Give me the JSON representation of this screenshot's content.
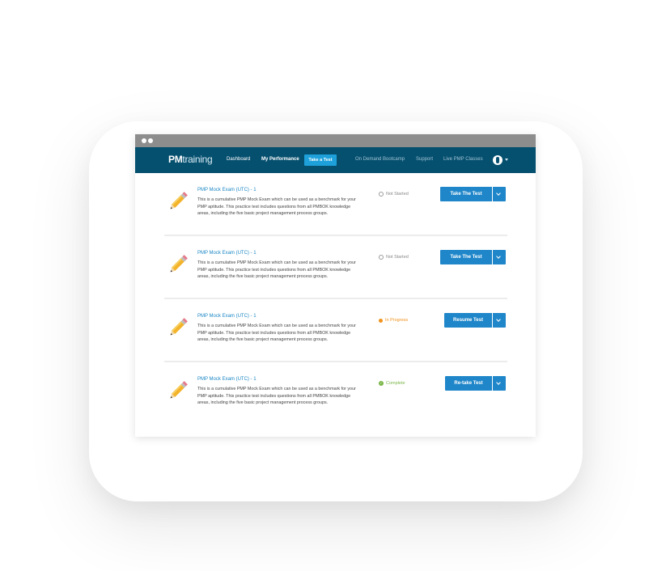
{
  "header": {
    "logo_bold": "PM",
    "logo_light": "training",
    "nav": {
      "dashboard": "Dashboard",
      "my_performance": "My Performance",
      "take_a_test": "Take a Test",
      "on_demand": "On Demand Bootcamp",
      "support": "Support",
      "live_classes": "Live PMP Classes"
    },
    "avatar_icon": "user-icon"
  },
  "colors": {
    "navbar": "#06506f",
    "titlebar": "#8d8d8d",
    "accent": "#1f86c9",
    "in_progress": "#f0931f",
    "complete": "#7ab648"
  },
  "tests": [
    {
      "title": "PMP Mock Exam (UTC) - 1",
      "description": "This is a cumulative PMP Mock Exam which can be used as a benchmark for your PMP aptitude. This practice test includes questions from all PMBOK knowledge areas, including the five basic project management process groups.",
      "status": "Not Started",
      "action": "Take The Test"
    },
    {
      "title": "PMP Mock Exam (UTC) - 1",
      "description": "This is a cumulative PMP Mock Exam which can be used as a benchmark for your PMP aptitude. This practice test includes questions from all PMBOK knowledge areas, including the five basic project management process groups.",
      "status": "Not Started",
      "action": "Take The Test"
    },
    {
      "title": "PMP Mock Exam (UTC) - 1",
      "description": "This is a cumulative PMP Mock Exam which can be used as a benchmark for your PMP aptitude. This practice test includes questions from all PMBOK knowledge areas, including the five basic project management process groups.",
      "status": "In Progress",
      "action": "Resume Test"
    },
    {
      "title": "PMP Mock Exam (UTC) - 1",
      "description": "This is a cumulative PMP Mock Exam which can be used as a benchmark for your PMP aptitude. This practice test includes questions from all PMBOK knowledge areas, including the five basic project management process groups.",
      "status": "Complete",
      "action": "Re-take Test"
    }
  ]
}
